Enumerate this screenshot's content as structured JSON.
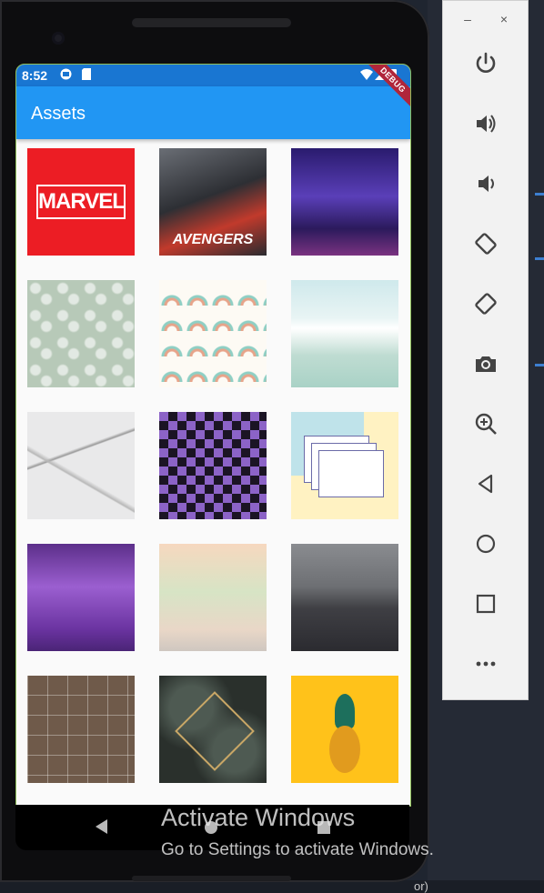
{
  "status_bar": {
    "time": "8:52"
  },
  "app_bar": {
    "title": "Assets",
    "debug_label": "DEBUG"
  },
  "grid": {
    "tiles": [
      {
        "name": "marvel-logo",
        "label": "MARVEL"
      },
      {
        "name": "avengers-poster",
        "label": "AVENGERS"
      },
      {
        "name": "endgame-poster",
        "label": ""
      },
      {
        "name": "leaf-pattern",
        "label": ""
      },
      {
        "name": "rainbow-pattern",
        "label": ""
      },
      {
        "name": "city-skyline",
        "label": ""
      },
      {
        "name": "photo-collage",
        "label": ""
      },
      {
        "name": "checker-room",
        "label": ""
      },
      {
        "name": "retro-windows",
        "label": ""
      },
      {
        "name": "purple-cactus",
        "label": ""
      },
      {
        "name": "jungle-mural",
        "label": ""
      },
      {
        "name": "dark-room",
        "label": ""
      },
      {
        "name": "photo-wall",
        "label": ""
      },
      {
        "name": "gold-frame-leaves",
        "label": ""
      },
      {
        "name": "pineapple",
        "label": ""
      }
    ]
  },
  "emulator_panel": {
    "minimize_label": "–",
    "close_label": "×",
    "controls": [
      "power-icon",
      "volume-up-icon",
      "volume-down-icon",
      "rotate-left-icon",
      "rotate-right-icon",
      "camera-icon",
      "zoom-icon",
      "back-icon",
      "home-icon",
      "overview-icon",
      "more-icon"
    ]
  },
  "watermark": {
    "title": "Activate Windows",
    "subtitle": "Go to Settings to activate Windows."
  },
  "ide_status": {
    "text": "or)"
  }
}
